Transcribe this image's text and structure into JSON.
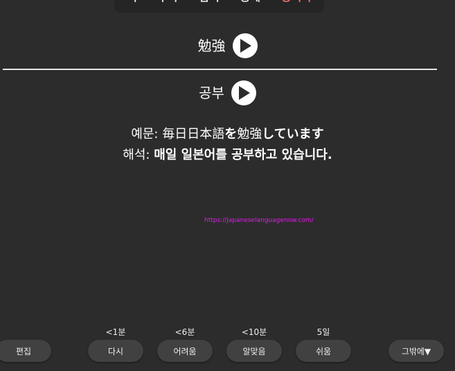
{
  "nav": {
    "items": [
      {
        "label": "색"
      },
      {
        "label": "추가"
      },
      {
        "label": "검색"
      },
      {
        "label": "통계"
      },
      {
        "label": "동기화"
      }
    ]
  },
  "card": {
    "front_word": "勉強",
    "back_word": "공부",
    "example_label": "예문: ",
    "example_kanji": "毎日日本語",
    "example_particle": "を",
    "example_kanji2": "勉強",
    "example_tail": "しています",
    "translation_label": "해석: ",
    "translation": "매일 일본어를 공부하고 있습니다.",
    "source_url": "https://japaneselanguagenow.com/"
  },
  "colors": {
    "background": "#2c2c2c",
    "active_tab": "#f07070",
    "link": "#e21ce8",
    "button": "#414141"
  },
  "bottom": {
    "edit_label": "편집",
    "more_label": "그밖에▼",
    "answers": [
      {
        "interval": "<1분",
        "label": "다시"
      },
      {
        "interval": "<6분",
        "label": "어려움"
      },
      {
        "interval": "<10분",
        "label": "알맞음"
      },
      {
        "interval": "5일",
        "label": "쉬움"
      }
    ]
  }
}
